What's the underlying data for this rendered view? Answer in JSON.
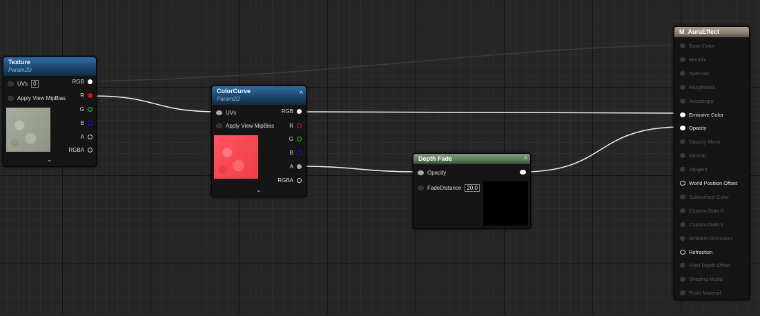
{
  "colors": {
    "texture_header": "#1d4c75",
    "depth_fade_header": "#5a7a5a",
    "material_header": "#8a7e73",
    "wire": "#f2f2f2",
    "red_pin": "#e01010",
    "green_pin": "#1fcf1f",
    "blue_pin": "#1a1ad8"
  },
  "texture_node": {
    "title": "Texture",
    "subtitle": "Param2D",
    "inputs": {
      "uvs_label": "UVs",
      "uvs_value": "0",
      "mipbias_label": "Apply View MipBias"
    },
    "outputs": [
      "RGB",
      "R",
      "G",
      "B",
      "A",
      "RGBA"
    ]
  },
  "colorcurve_node": {
    "title": "ColorCurve",
    "subtitle": "Param2D",
    "inputs": {
      "uvs_label": "UVs",
      "mipbias_label": "Apply View MipBias"
    },
    "outputs": [
      "RGB",
      "R",
      "G",
      "B",
      "A",
      "RGBA"
    ]
  },
  "depthfade_node": {
    "title": "Depth Fade",
    "input_opacity": "Opacity",
    "fade_label": "FadeDistance",
    "fade_value": "20.0"
  },
  "material_node": {
    "title": "M_AuraEffect",
    "pins": [
      {
        "label": "Base Color",
        "active": false
      },
      {
        "label": "Metallic",
        "active": false
      },
      {
        "label": "Specular",
        "active": false
      },
      {
        "label": "Roughness",
        "active": false
      },
      {
        "label": "Anisotropy",
        "active": false
      },
      {
        "label": "Emissive Color",
        "active": true,
        "connected": true
      },
      {
        "label": "Opacity",
        "active": true,
        "connected": true
      },
      {
        "label": "Opacity Mask",
        "active": false
      },
      {
        "label": "Normal",
        "active": false
      },
      {
        "label": "Tangent",
        "active": false
      },
      {
        "label": "World Position Offset",
        "active": true
      },
      {
        "label": "Subsurface Color",
        "active": false
      },
      {
        "label": "Custom Data 0",
        "active": false
      },
      {
        "label": "Custom Data 1",
        "active": false
      },
      {
        "label": "Ambient Occlusion",
        "active": false
      },
      {
        "label": "Refraction",
        "active": true
      },
      {
        "label": "Pixel Depth Offset",
        "active": false
      },
      {
        "label": "Shading Model",
        "active": false
      },
      {
        "label": "Front Material",
        "active": false
      }
    ]
  }
}
